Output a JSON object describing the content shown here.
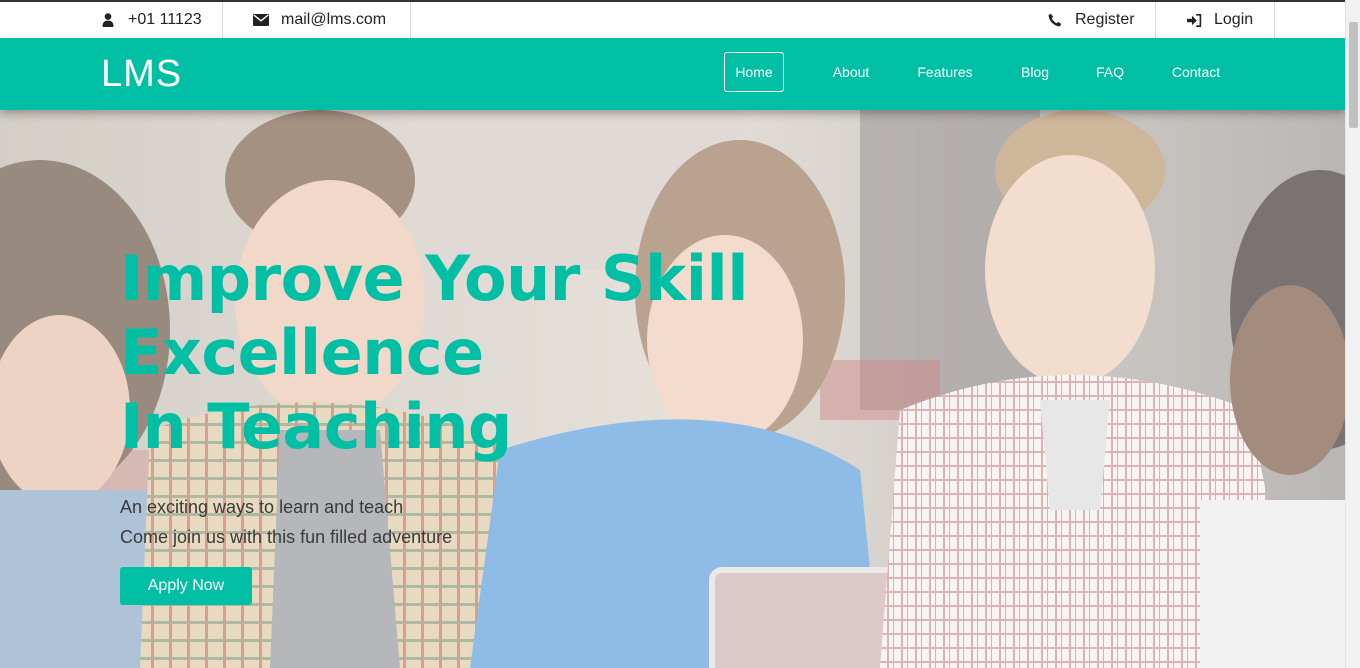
{
  "topbar": {
    "phone": {
      "text": "+01 11123",
      "icon": "user-icon"
    },
    "email": {
      "text": "mail@lms.com",
      "icon": "envelope-icon"
    },
    "register": {
      "text": "Register",
      "icon": "phone-icon"
    },
    "login": {
      "text": "Login",
      "icon": "sign-in-icon"
    }
  },
  "nav": {
    "brand": "LMS",
    "links": [
      "Home",
      "About",
      "Features",
      "Blog",
      "FAQ",
      "Contact"
    ],
    "active": "Home"
  },
  "hero": {
    "headline": [
      "Improve Your Skill",
      "Excellence",
      "In Teaching"
    ],
    "subtext": [
      "An exciting ways to learn and teach",
      "Come join us with this fun filled adventure"
    ],
    "cta": "Apply Now"
  },
  "colors": {
    "accent": "#00bfa5",
    "body_text": "#3a3a3a",
    "topbar_text": "#222222"
  }
}
